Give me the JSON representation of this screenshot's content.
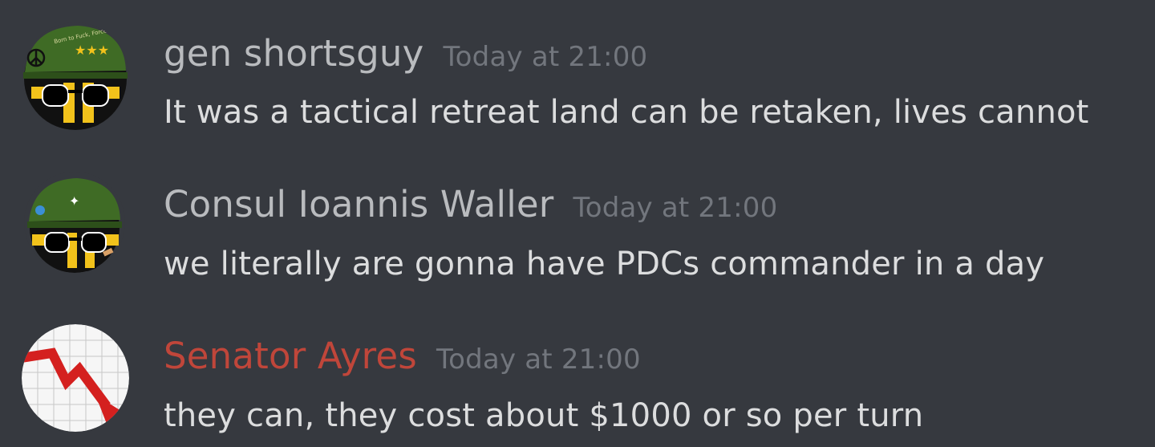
{
  "messages": [
    {
      "author": "gen shortsguy",
      "author_color": "#b9bbbe",
      "timestamp": "Today at 21:00",
      "content": "It was a tactical retreat land can be retaken, lives cannot",
      "avatar_icon": "helmet-ball-avatar-icon",
      "avatar_text": "Born to Fuck, Forced to Slack"
    },
    {
      "author": "Consul Ioannis Waller",
      "author_color": "#b9bbbe",
      "timestamp": "Today at 21:00",
      "content": "we literally are gonna have PDCs commander in a day",
      "avatar_icon": "helmet-ball-avatar-icon"
    },
    {
      "author": "Senator Ayres",
      "author_color": "#c0463a",
      "timestamp": "Today at 21:00",
      "content": "they can, they cost about $1000 or so per turn",
      "avatar_icon": "declining-chart-avatar-icon"
    }
  ]
}
